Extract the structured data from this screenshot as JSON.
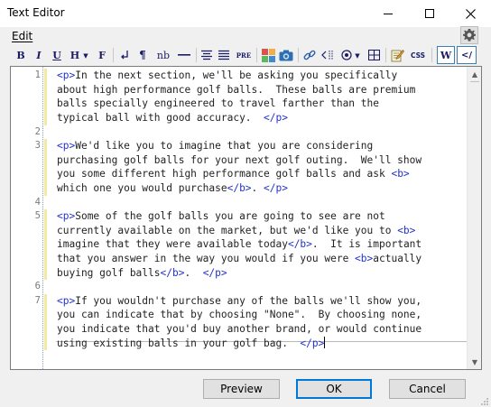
{
  "window": {
    "title": "Text Editor"
  },
  "menu": {
    "edit_label": "Edit"
  },
  "toolbar": {
    "bold": "B",
    "italic": "I",
    "underline": "U",
    "heading": "H",
    "font": "F",
    "pre": "PRE",
    "nb": "nb",
    "pilcrow": "¶",
    "css": "CSS",
    "word": "W",
    "source": "</"
  },
  "editor": {
    "line_numbers": [
      "1",
      "2",
      "3",
      "4",
      "5",
      "6",
      "7"
    ],
    "paragraphs": [
      {
        "number": "1",
        "lines": [
          [
            {
              "tag": "<p>"
            },
            {
              "text": "In the next section, we'll be asking you specifically"
            }
          ],
          [
            {
              "text": "about high performance golf balls.  These balls are premium"
            }
          ],
          [
            {
              "text": "balls specially engineered to travel farther than the"
            }
          ],
          [
            {
              "text": "typical ball with good accuracy.  "
            },
            {
              "tag": "</p>"
            }
          ]
        ]
      },
      {
        "number": "3",
        "lines": [
          [
            {
              "tag": "<p>"
            },
            {
              "text": "We'd like you to imagine that you are considering"
            }
          ],
          [
            {
              "text": "purchasing golf balls for your next golf outing.  We'll show"
            }
          ],
          [
            {
              "text": "you some different high performance golf balls and ask "
            },
            {
              "tag": "<b>"
            }
          ],
          [
            {
              "text": "which one you would purchase"
            },
            {
              "tag": "</b>"
            },
            {
              "text": ". "
            },
            {
              "tag": "</p>"
            }
          ]
        ]
      },
      {
        "number": "5",
        "lines": [
          [
            {
              "tag": "<p>"
            },
            {
              "text": "Some of the golf balls you are going to see are not"
            }
          ],
          [
            {
              "text": "currently available on the market, but we'd like you to "
            },
            {
              "tag": "<b>"
            }
          ],
          [
            {
              "text": "imagine that they were available today"
            },
            {
              "tag": "</b>"
            },
            {
              "text": ".  It is important"
            }
          ],
          [
            {
              "text": "that you answer in the way you would if you were "
            },
            {
              "tag": "<b>"
            },
            {
              "text": "actually"
            }
          ],
          [
            {
              "text": "buying golf balls"
            },
            {
              "tag": "</b>"
            },
            {
              "text": ".  "
            },
            {
              "tag": "</p>"
            }
          ]
        ]
      },
      {
        "number": "7",
        "lines": [
          [
            {
              "tag": "<p>"
            },
            {
              "text": "If you wouldn't purchase any of the balls we'll show you,"
            }
          ],
          [
            {
              "text": "you can indicate that by choosing \"None\".  By choosing none,"
            }
          ],
          [
            {
              "text": "you indicate that you'd buy another brand, or would continue"
            }
          ],
          [
            {
              "text": "using existing balls in your golf bag.  "
            },
            {
              "tag": "</p>"
            }
          ]
        ]
      }
    ]
  },
  "buttons": {
    "preview": "Preview",
    "ok": "OK",
    "cancel": "Cancel"
  },
  "colors": {
    "tag": "#2233cc",
    "accent": "#0078d7",
    "changebar": "#f4e9a0"
  },
  "icons": [
    "minimize-icon",
    "maximize-icon",
    "close-icon",
    "gear-icon",
    "line-break-icon",
    "pilcrow-icon",
    "horizontal-rule-icon",
    "align-center-icon",
    "align-justify-icon",
    "color-palette-icon",
    "camera-icon",
    "link-icon",
    "anchor-arrow-icon",
    "symbol-icon",
    "table-icon",
    "edit-style-icon"
  ]
}
